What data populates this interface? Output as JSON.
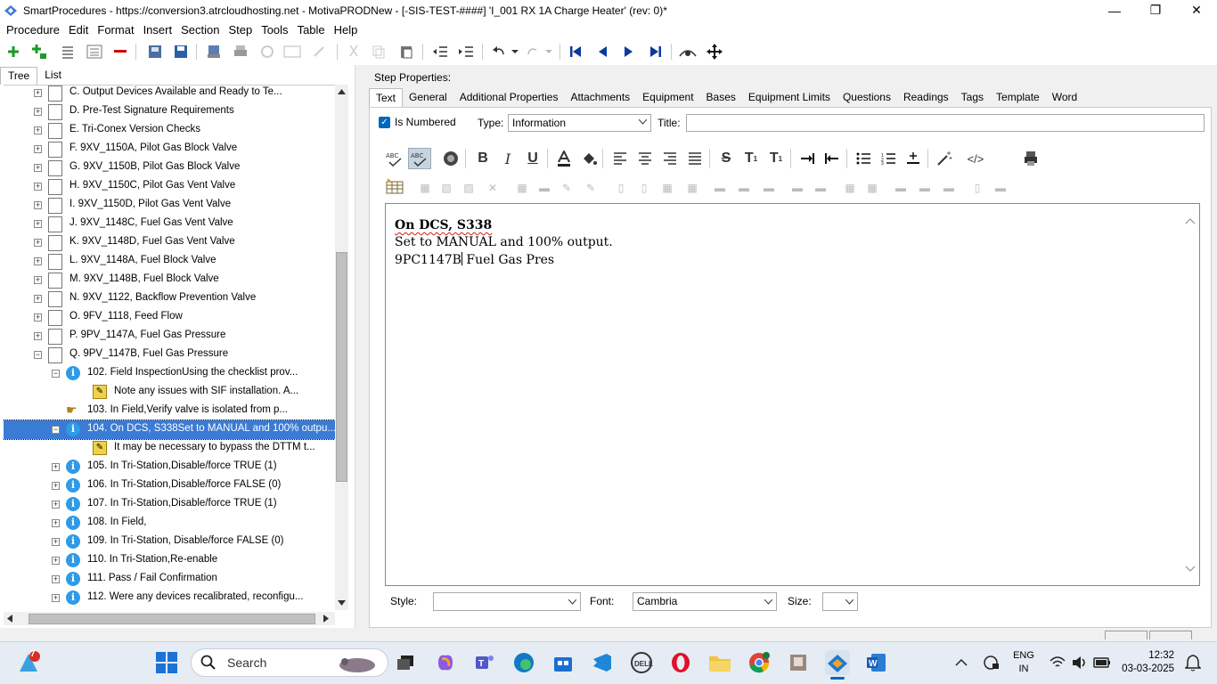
{
  "window": {
    "title": "SmartProcedures - https://conversion3.atrcloudhosting.net - MotivaPRODNew - [-SIS-TEST-####] 'I_001 RX 1A Charge Heater' (rev: 0)*",
    "minimize": "—",
    "maximize": "❐",
    "close": "✕"
  },
  "menu": [
    "Procedure",
    "Edit",
    "Format",
    "Insert",
    "Section",
    "Step",
    "Tools",
    "Table",
    "Help"
  ],
  "left_tabs": [
    "Tree",
    "List"
  ],
  "tree": [
    {
      "label": "C. Output Devices Available and Ready to Te...",
      "icon": "doc",
      "expander": "+",
      "level": 0
    },
    {
      "label": "D. Pre-Test Signature Requirements",
      "icon": "doc",
      "expander": "+",
      "level": 0
    },
    {
      "label": "E. Tri-Conex Version Checks",
      "icon": "doc",
      "expander": "+",
      "level": 0
    },
    {
      "label": "F. 9XV_1150A, Pilot Gas Block Valve",
      "icon": "doc",
      "expander": "+",
      "level": 0
    },
    {
      "label": "G. 9XV_1150B, Pilot Gas Block Valve",
      "icon": "doc",
      "expander": "+",
      "level": 0
    },
    {
      "label": "H. 9XV_1150C, Pilot Gas Vent Valve",
      "icon": "doc",
      "expander": "+",
      "level": 0
    },
    {
      "label": "I. 9XV_1150D, Pilot Gas Vent Valve",
      "icon": "doc",
      "expander": "+",
      "level": 0
    },
    {
      "label": "J. 9XV_1148C, Fuel Gas Vent Valve",
      "icon": "doc",
      "expander": "+",
      "level": 0
    },
    {
      "label": "K. 9XV_1148D, Fuel Gas Vent Valve",
      "icon": "doc",
      "expander": "+",
      "level": 0
    },
    {
      "label": "L. 9XV_1148A, Fuel Block Valve",
      "icon": "doc",
      "expander": "+",
      "level": 0
    },
    {
      "label": "M. 9XV_1148B, Fuel Block Valve",
      "icon": "doc",
      "expander": "+",
      "level": 0
    },
    {
      "label": "N. 9XV_1122, Backflow Prevention Valve",
      "icon": "doc",
      "expander": "+",
      "level": 0
    },
    {
      "label": "O. 9FV_1118, Feed Flow",
      "icon": "doc",
      "expander": "+",
      "level": 0
    },
    {
      "label": "P. 9PV_1147A, Fuel Gas Pressure",
      "icon": "doc",
      "expander": "+",
      "level": 0
    },
    {
      "label": "Q. 9PV_1147B, Fuel Gas Pressure",
      "icon": "doc",
      "expander": "−",
      "level": 0
    },
    {
      "label": "102. Field InspectionUsing the checklist prov...",
      "icon": "info",
      "expander": "−",
      "level": 1
    },
    {
      "label": "Note any issues with SIF installation. A...",
      "icon": "note",
      "expander": "",
      "level": 2
    },
    {
      "label": "103. In Field,Verify valve is isolated from p...",
      "icon": "hand",
      "expander": "",
      "level": 1
    },
    {
      "label": "104. On DCS, S338Set to MANUAL and 100% outpu...",
      "icon": "info",
      "expander": "−",
      "level": 1,
      "selected": true
    },
    {
      "label": "It may be necessary to bypass the DTTM t...",
      "icon": "note",
      "expander": "",
      "level": 2
    },
    {
      "label": "105. In Tri-Station,Disable/force TRUE (1)",
      "icon": "info",
      "expander": "+",
      "level": 1
    },
    {
      "label": "106. In Tri-Station,Disable/force FALSE (0)",
      "icon": "info",
      "expander": "+",
      "level": 1
    },
    {
      "label": "107. In Tri-Station,Disable/force TRUE (1)",
      "icon": "info",
      "expander": "+",
      "level": 1
    },
    {
      "label": "108. In Field,",
      "icon": "info",
      "expander": "+",
      "level": 1
    },
    {
      "label": "109. In Tri-Station, Disable/force FALSE (0)",
      "icon": "info",
      "expander": "+",
      "level": 1
    },
    {
      "label": "110. In Tri-Station,Re-enable",
      "icon": "info",
      "expander": "+",
      "level": 1
    },
    {
      "label": "111. Pass / Fail Confirmation",
      "icon": "info",
      "expander": "+",
      "level": 1
    },
    {
      "label": "112. Were any devices recalibrated, reconfigu...",
      "icon": "info",
      "expander": "+",
      "level": 1
    }
  ],
  "step_properties": {
    "heading": "Step Properties:",
    "tabs": [
      "Text",
      "General",
      "Additional Properties",
      "Attachments",
      "Equipment",
      "Bases",
      "Equipment Limits",
      "Questions",
      "Readings",
      "Tags",
      "Template",
      "Word"
    ],
    "is_numbered_label": "Is Numbered",
    "is_numbered_checked": true,
    "type_label": "Type:",
    "type_value": "Information",
    "title_label": "Title:",
    "title_value": ""
  },
  "editor": {
    "line1": "On DCS, S338",
    "line2": "Set to MANUAL and 100% output.",
    "line3a": "9PC1147B",
    "line3b": " Fuel Gas Pres"
  },
  "bottom": {
    "style_label": "Style:",
    "style_value": "",
    "font_label": "Font:",
    "font_value": "Cambria",
    "size_label": "Size:",
    "size_value": ""
  },
  "taskbar": {
    "search_placeholder": "Search",
    "notification_badge": "7",
    "lang_line1": "ENG",
    "lang_line2": "IN",
    "time": "12:32",
    "date": "03-03-2025"
  },
  "colors": {
    "selection": "#3a7bd5",
    "info_icon": "#2f9be8",
    "accent": "#0067c0"
  }
}
